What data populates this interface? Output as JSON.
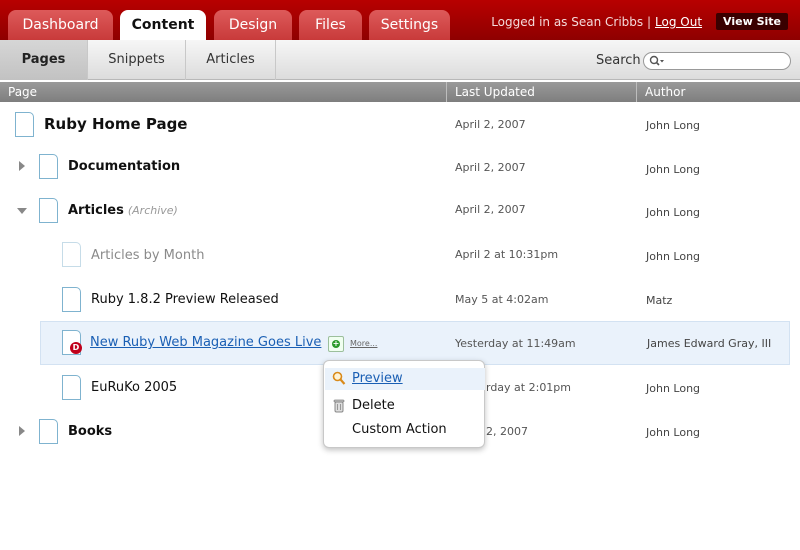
{
  "top_nav": {
    "tabs": [
      "Dashboard",
      "Content",
      "Design",
      "Files",
      "Settings"
    ],
    "active_tab": "Content",
    "logged_in_text": "Logged in as Sean Cribbs |",
    "logout_label": "Log Out",
    "view_site_label": "View Site"
  },
  "sub_nav": {
    "tabs": [
      "Pages",
      "Snippets",
      "Articles"
    ],
    "active_tab": "Pages",
    "search_label": "Search"
  },
  "columns": {
    "page": "Page",
    "last_updated": "Last Updated",
    "author": "Author"
  },
  "rows": [
    {
      "title": "Ruby Home Page",
      "updated": "April 2, 2007",
      "author": "John Long"
    },
    {
      "title": "Documentation",
      "updated": "April 2, 2007",
      "author": "John Long",
      "expander": "collapsed"
    },
    {
      "title": "Articles",
      "tag": "(Archive)",
      "updated": "April 2, 2007",
      "author": "John Long",
      "expander": "expanded"
    },
    {
      "title": "Articles by Month",
      "updated": "April 2 at 10:31pm",
      "author": "John Long"
    },
    {
      "title": "Ruby 1.8.2 Preview Released",
      "updated": "May 5 at 4:02am",
      "author": "Matz"
    },
    {
      "title": "New Ruby Web Magazine Goes Live",
      "updated": "Yesterday at 11:49am",
      "author": "James Edward Gray, III",
      "badge": "D",
      "more_label": "More..."
    },
    {
      "title": "EuRuKo 2005",
      "updated": "rday at 2:01pm",
      "author": "John Long"
    },
    {
      "title": "Books",
      "updated": "2, 2007",
      "author": "John Long",
      "expander": "collapsed"
    }
  ],
  "context_menu": {
    "items": [
      "Preview",
      "Delete",
      "Custom Action"
    ]
  },
  "colors": {
    "brand_red": "#a00000",
    "link_blue": "#1a5fb4",
    "selected_row": "#eaf2fb"
  },
  "icons": [
    "page-icon",
    "expand-arrow-icon",
    "collapse-arrow-icon",
    "draft-badge-icon",
    "add-child-icon",
    "magnifier-icon",
    "trash-icon"
  ]
}
